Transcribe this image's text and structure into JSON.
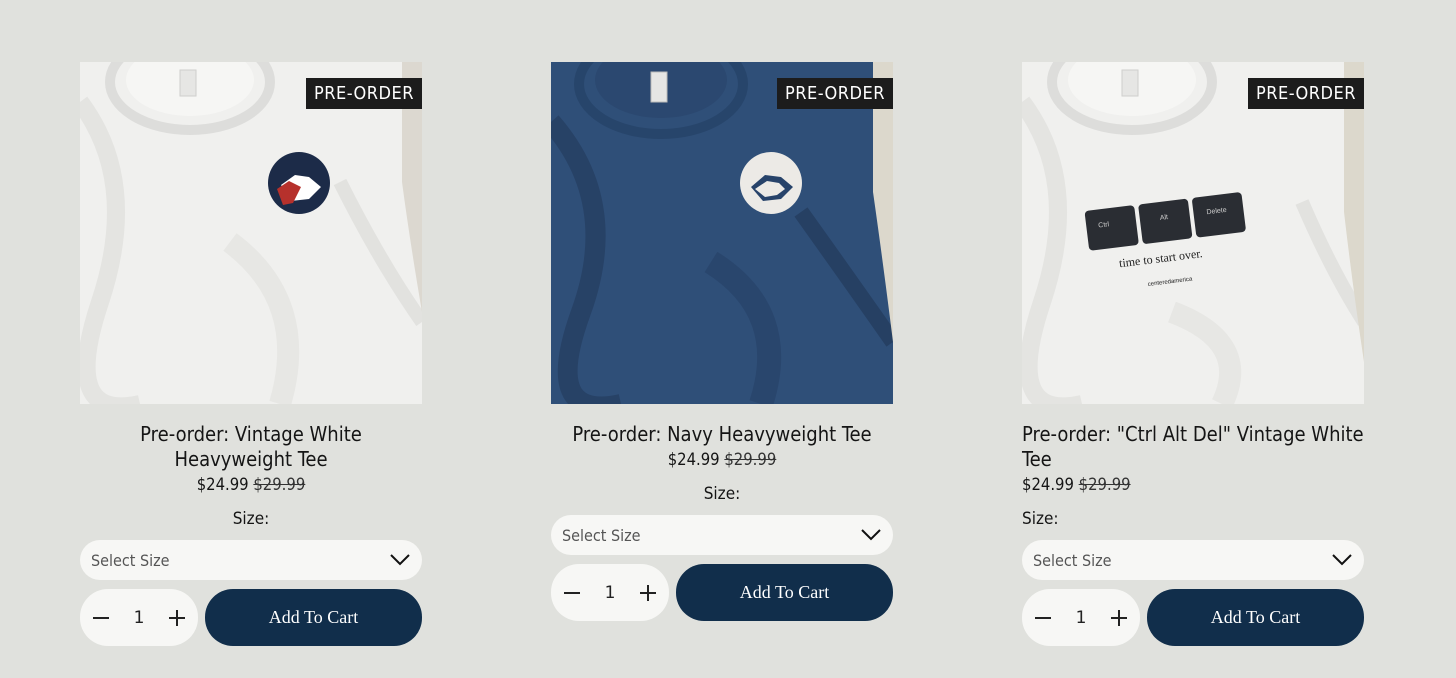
{
  "products": [
    {
      "badge": "PRE-ORDER",
      "title": "Pre-order: Vintage White Heavyweight Tee",
      "price": "$24.99",
      "compare_price": "$29.99",
      "size_label": "Size:",
      "size_select": "Select Size",
      "quantity": "1",
      "add_to_cart": "Add To Cart",
      "shirt_color": "#f2f2f0",
      "image_icon": "handshake-emblem-red-navy"
    },
    {
      "badge": "PRE-ORDER",
      "title": "Pre-order: Navy Heavyweight Tee",
      "price": "$24.99",
      "compare_price": "$29.99",
      "size_label": "Size:",
      "size_select": "Select Size",
      "quantity": "1",
      "add_to_cart": "Add To Cart",
      "shirt_color": "#2f4f78",
      "image_icon": "handshake-emblem-white"
    },
    {
      "badge": "PRE-ORDER",
      "title": "Pre-order: \"Ctrl Alt Del\" Vintage White Tee",
      "price": "$24.99",
      "compare_price": "$29.99",
      "size_label": "Size:",
      "size_select": "Select Size",
      "quantity": "1",
      "add_to_cart": "Add To Cart",
      "shirt_color": "#f2f2f0",
      "image_icon": "ctrl-alt-delete-keys",
      "print": {
        "keys": [
          "Ctrl",
          "Alt",
          "Delete"
        ],
        "tagline": "time to start over.",
        "brand": "centeredamerica"
      }
    }
  ],
  "colors": {
    "button": "#112e4b",
    "badge": "#1c1c1c",
    "background": "#e0e1dd"
  }
}
